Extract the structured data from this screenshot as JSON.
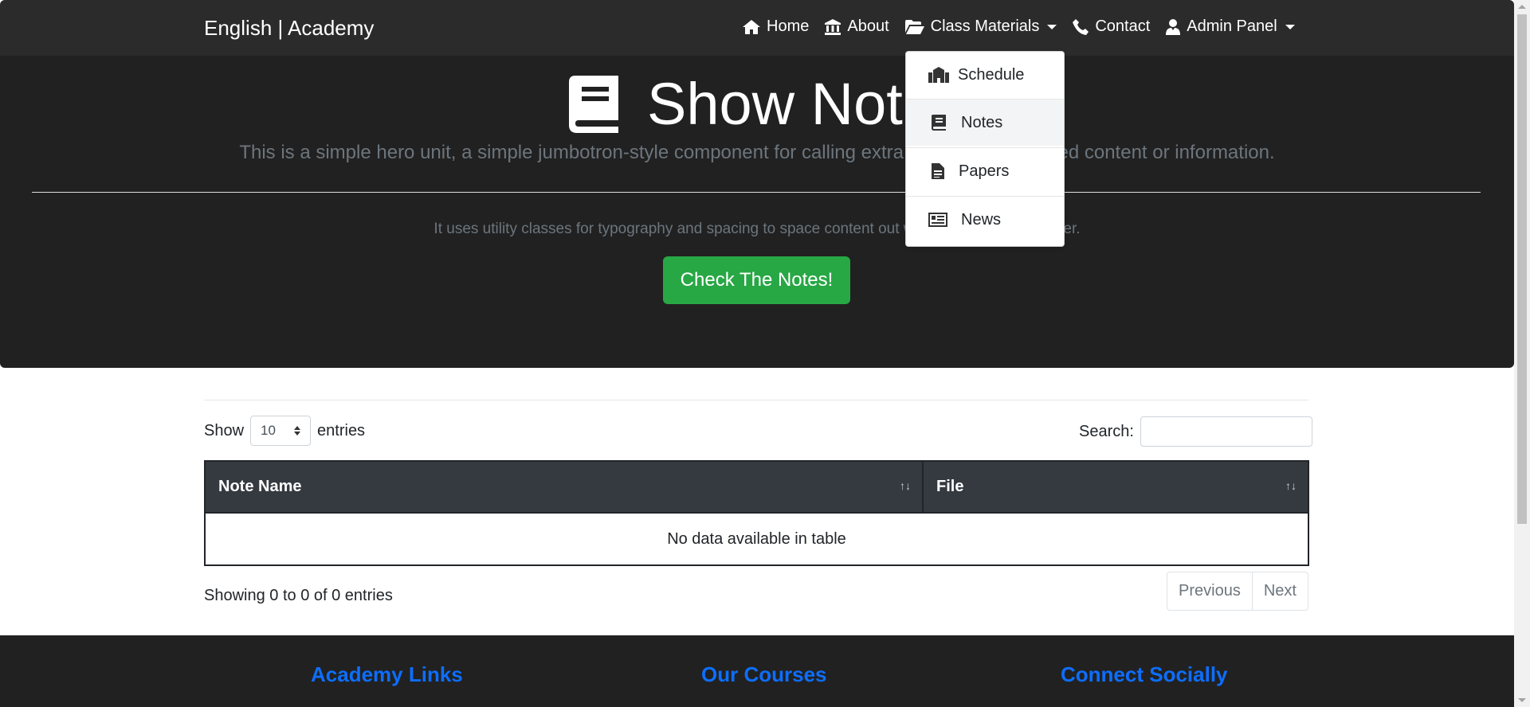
{
  "navbar": {
    "brand": "English | Academy",
    "items": [
      {
        "label": "Home",
        "icon": "home-icon"
      },
      {
        "label": "About",
        "icon": "university-icon"
      },
      {
        "label": "Class Materials",
        "icon": "folder-open-icon",
        "dropdown": true
      },
      {
        "label": "Contact",
        "icon": "phone-icon"
      },
      {
        "label": "Admin Panel",
        "icon": "user-tie-icon",
        "dropdown": true
      }
    ]
  },
  "dropdown": {
    "items": [
      {
        "label": "Schedule",
        "icon": "school-icon"
      },
      {
        "label": "Notes",
        "icon": "book-icon"
      },
      {
        "label": "Papers",
        "icon": "file-alt-icon"
      },
      {
        "label": "News",
        "icon": "newspaper-icon"
      }
    ],
    "active_index": 1
  },
  "hero": {
    "title": "Show Notes",
    "lead": "This is a simple hero unit, a simple jumbotron-style component for calling extra attention to featured content or information.",
    "sub": "It uses utility classes for typography and spacing to space content out within the larger container.",
    "button": "Check The Notes!"
  },
  "table": {
    "show_label": "Show",
    "entries_label": "entries",
    "length_value": "10",
    "search_label": "Search:",
    "search_value": "",
    "columns": [
      "Note Name",
      "File"
    ],
    "sort_glyph": "↑↓",
    "empty_text": "No data available in table",
    "info": "Showing 0 to 0 of 0 entries",
    "prev_label": "Previous",
    "next_label": "Next"
  },
  "footer": {
    "headings": [
      "Academy Links",
      "Our Courses",
      "Connect Socially"
    ]
  },
  "colors": {
    "navbar_bg": "#2b2b2b",
    "hero_bg": "#212121",
    "success": "#28a745",
    "footer_heading": "#0d6efd",
    "table_head_bg": "#343a40"
  }
}
